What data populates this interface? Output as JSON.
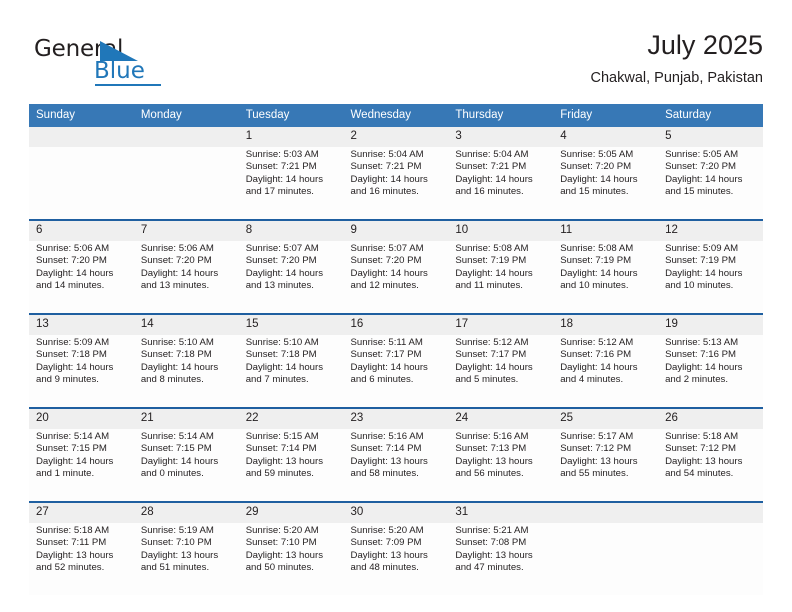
{
  "logo": {
    "word_one": "General",
    "word_two": "Blue",
    "triangle_icon": "triangle-icon"
  },
  "header": {
    "title": "July 2025",
    "subtitle": "Chakwal, Punjab, Pakistan"
  },
  "colors": {
    "header_blue": "#3778b6",
    "separator_blue": "#1f5fa0",
    "daynum_band": "#efefef",
    "logo_blue": "#2077b9",
    "text": "#231f20"
  },
  "calendar": {
    "weekday_headers": [
      "Sunday",
      "Monday",
      "Tuesday",
      "Wednesday",
      "Thursday",
      "Friday",
      "Saturday"
    ],
    "weeks": [
      [
        {
          "day": "",
          "lines": []
        },
        {
          "day": "",
          "lines": []
        },
        {
          "day": "1",
          "lines": [
            "Sunrise: 5:03 AM",
            "Sunset: 7:21 PM",
            "Daylight: 14 hours",
            "and 17 minutes."
          ]
        },
        {
          "day": "2",
          "lines": [
            "Sunrise: 5:04 AM",
            "Sunset: 7:21 PM",
            "Daylight: 14 hours",
            "and 16 minutes."
          ]
        },
        {
          "day": "3",
          "lines": [
            "Sunrise: 5:04 AM",
            "Sunset: 7:21 PM",
            "Daylight: 14 hours",
            "and 16 minutes."
          ]
        },
        {
          "day": "4",
          "lines": [
            "Sunrise: 5:05 AM",
            "Sunset: 7:20 PM",
            "Daylight: 14 hours",
            "and 15 minutes."
          ]
        },
        {
          "day": "5",
          "lines": [
            "Sunrise: 5:05 AM",
            "Sunset: 7:20 PM",
            "Daylight: 14 hours",
            "and 15 minutes."
          ]
        }
      ],
      [
        {
          "day": "6",
          "lines": [
            "Sunrise: 5:06 AM",
            "Sunset: 7:20 PM",
            "Daylight: 14 hours",
            "and 14 minutes."
          ]
        },
        {
          "day": "7",
          "lines": [
            "Sunrise: 5:06 AM",
            "Sunset: 7:20 PM",
            "Daylight: 14 hours",
            "and 13 minutes."
          ]
        },
        {
          "day": "8",
          "lines": [
            "Sunrise: 5:07 AM",
            "Sunset: 7:20 PM",
            "Daylight: 14 hours",
            "and 13 minutes."
          ]
        },
        {
          "day": "9",
          "lines": [
            "Sunrise: 5:07 AM",
            "Sunset: 7:20 PM",
            "Daylight: 14 hours",
            "and 12 minutes."
          ]
        },
        {
          "day": "10",
          "lines": [
            "Sunrise: 5:08 AM",
            "Sunset: 7:19 PM",
            "Daylight: 14 hours",
            "and 11 minutes."
          ]
        },
        {
          "day": "11",
          "lines": [
            "Sunrise: 5:08 AM",
            "Sunset: 7:19 PM",
            "Daylight: 14 hours",
            "and 10 minutes."
          ]
        },
        {
          "day": "12",
          "lines": [
            "Sunrise: 5:09 AM",
            "Sunset: 7:19 PM",
            "Daylight: 14 hours",
            "and 10 minutes."
          ]
        }
      ],
      [
        {
          "day": "13",
          "lines": [
            "Sunrise: 5:09 AM",
            "Sunset: 7:18 PM",
            "Daylight: 14 hours",
            "and 9 minutes."
          ]
        },
        {
          "day": "14",
          "lines": [
            "Sunrise: 5:10 AM",
            "Sunset: 7:18 PM",
            "Daylight: 14 hours",
            "and 8 minutes."
          ]
        },
        {
          "day": "15",
          "lines": [
            "Sunrise: 5:10 AM",
            "Sunset: 7:18 PM",
            "Daylight: 14 hours",
            "and 7 minutes."
          ]
        },
        {
          "day": "16",
          "lines": [
            "Sunrise: 5:11 AM",
            "Sunset: 7:17 PM",
            "Daylight: 14 hours",
            "and 6 minutes."
          ]
        },
        {
          "day": "17",
          "lines": [
            "Sunrise: 5:12 AM",
            "Sunset: 7:17 PM",
            "Daylight: 14 hours",
            "and 5 minutes."
          ]
        },
        {
          "day": "18",
          "lines": [
            "Sunrise: 5:12 AM",
            "Sunset: 7:16 PM",
            "Daylight: 14 hours",
            "and 4 minutes."
          ]
        },
        {
          "day": "19",
          "lines": [
            "Sunrise: 5:13 AM",
            "Sunset: 7:16 PM",
            "Daylight: 14 hours",
            "and 2 minutes."
          ]
        }
      ],
      [
        {
          "day": "20",
          "lines": [
            "Sunrise: 5:14 AM",
            "Sunset: 7:15 PM",
            "Daylight: 14 hours",
            "and 1 minute."
          ]
        },
        {
          "day": "21",
          "lines": [
            "Sunrise: 5:14 AM",
            "Sunset: 7:15 PM",
            "Daylight: 14 hours",
            "and 0 minutes."
          ]
        },
        {
          "day": "22",
          "lines": [
            "Sunrise: 5:15 AM",
            "Sunset: 7:14 PM",
            "Daylight: 13 hours",
            "and 59 minutes."
          ]
        },
        {
          "day": "23",
          "lines": [
            "Sunrise: 5:16 AM",
            "Sunset: 7:14 PM",
            "Daylight: 13 hours",
            "and 58 minutes."
          ]
        },
        {
          "day": "24",
          "lines": [
            "Sunrise: 5:16 AM",
            "Sunset: 7:13 PM",
            "Daylight: 13 hours",
            "and 56 minutes."
          ]
        },
        {
          "day": "25",
          "lines": [
            "Sunrise: 5:17 AM",
            "Sunset: 7:12 PM",
            "Daylight: 13 hours",
            "and 55 minutes."
          ]
        },
        {
          "day": "26",
          "lines": [
            "Sunrise: 5:18 AM",
            "Sunset: 7:12 PM",
            "Daylight: 13 hours",
            "and 54 minutes."
          ]
        }
      ],
      [
        {
          "day": "27",
          "lines": [
            "Sunrise: 5:18 AM",
            "Sunset: 7:11 PM",
            "Daylight: 13 hours",
            "and 52 minutes."
          ]
        },
        {
          "day": "28",
          "lines": [
            "Sunrise: 5:19 AM",
            "Sunset: 7:10 PM",
            "Daylight: 13 hours",
            "and 51 minutes."
          ]
        },
        {
          "day": "29",
          "lines": [
            "Sunrise: 5:20 AM",
            "Sunset: 7:10 PM",
            "Daylight: 13 hours",
            "and 50 minutes."
          ]
        },
        {
          "day": "30",
          "lines": [
            "Sunrise: 5:20 AM",
            "Sunset: 7:09 PM",
            "Daylight: 13 hours",
            "and 48 minutes."
          ]
        },
        {
          "day": "31",
          "lines": [
            "Sunrise: 5:21 AM",
            "Sunset: 7:08 PM",
            "Daylight: 13 hours",
            "and 47 minutes."
          ]
        },
        {
          "day": "",
          "lines": []
        },
        {
          "day": "",
          "lines": []
        }
      ]
    ]
  }
}
